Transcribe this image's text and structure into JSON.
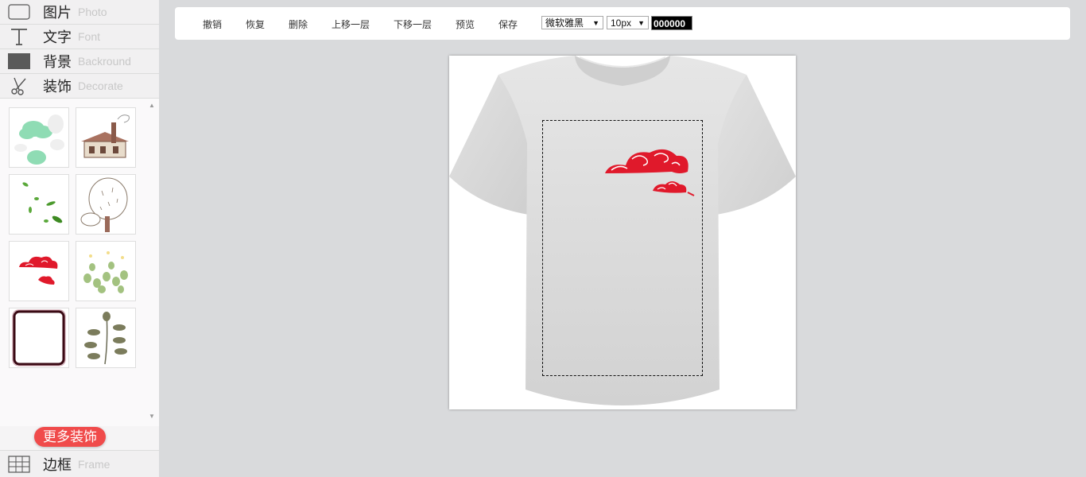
{
  "sidebar": {
    "categories": [
      {
        "zh": "图片",
        "en": "Photo",
        "icon": "image-frame-icon"
      },
      {
        "zh": "文字",
        "en": "Font",
        "icon": "text-t-icon"
      },
      {
        "zh": "背景",
        "en": "Backround",
        "icon": "background-square-icon"
      },
      {
        "zh": "装饰",
        "en": "Decorate",
        "icon": "scissors-icon"
      }
    ],
    "decorations": [
      "green-clouds",
      "cartoon-house",
      "falling-leaves",
      "sketch-tree",
      "red-auspicious-clouds",
      "green-plants",
      "dark-red-frame",
      "leafy-branch"
    ],
    "more_button": "更多装饰",
    "frame_category": {
      "zh": "边框",
      "en": "Frame",
      "icon": "grid-icon"
    }
  },
  "toolbar": {
    "undo": "撤销",
    "redo": "恢复",
    "delete": "删除",
    "move_up": "上移一层",
    "move_down": "下移一层",
    "preview": "预览",
    "save": "保存",
    "font_family": "微软雅黑",
    "font_size": "10px",
    "color_value": "000000"
  },
  "colors": {
    "accent_button": "#f04b4b",
    "cloud_red": "#e0192b",
    "tshirt": "#dcdcdc"
  }
}
